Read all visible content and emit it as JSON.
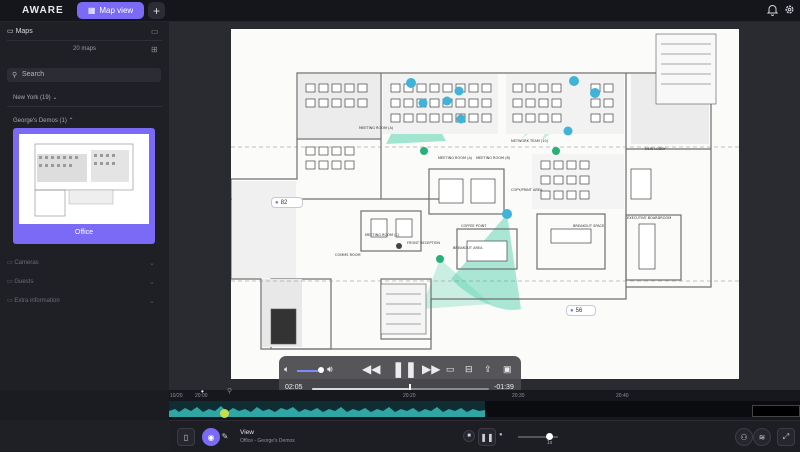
{
  "app": {
    "logo": "AWARE"
  },
  "topbar": {
    "map_view_label": "Map view",
    "add_label": "+",
    "bell_icon": "bell-icon",
    "settings_icon": "gear-icon"
  },
  "sidebar": {
    "maps_header": "Maps",
    "maps_count": "20 maps",
    "search_placeholder": "Search",
    "location": "New York (19)",
    "group": "George's Demos (1)",
    "card_label": "Office",
    "sections": [
      "Cameras",
      "Guests",
      "Extra information"
    ]
  },
  "map": {
    "labels": {
      "meeting_room_a": "MEETING ROOM (A)",
      "meeting_room_b": "MEETING ROOM (B)",
      "network_team": "NETWORK TEAM (10)",
      "new_lobby": "NEW LOBBY",
      "coffee_point": "COFFEE POINT",
      "copy_print": "COPY/PRINT AREA",
      "breakout": "BREAKOUT SPACE",
      "boardroom": "EXECUTIVE BOARDROOM",
      "breakout_area": "BREAKOUT AREA",
      "comms": "COMMS ROOM",
      "reception": "FRONT RECEPTION",
      "meeting_room_small": "MEETING ROOM (C)",
      "sales_team": "SALES TEAM (14)"
    },
    "badge_left": "82",
    "badge_right": "56",
    "colors": {
      "coverage": "#58d3ad",
      "camera": "#3fb3d8",
      "accent": "#7a6af5"
    }
  },
  "video": {
    "elapsed": "02:05",
    "remaining": "-01:39",
    "progress": 0.55,
    "volume": 0.75
  },
  "timeline": {
    "ticks": [
      "10/20",
      "20:00",
      "20:20",
      "20:30",
      "20:40"
    ],
    "cursor_label": ""
  },
  "bottom": {
    "title": "View",
    "subtitle": "Office - George's Demos",
    "speed": "1x"
  }
}
